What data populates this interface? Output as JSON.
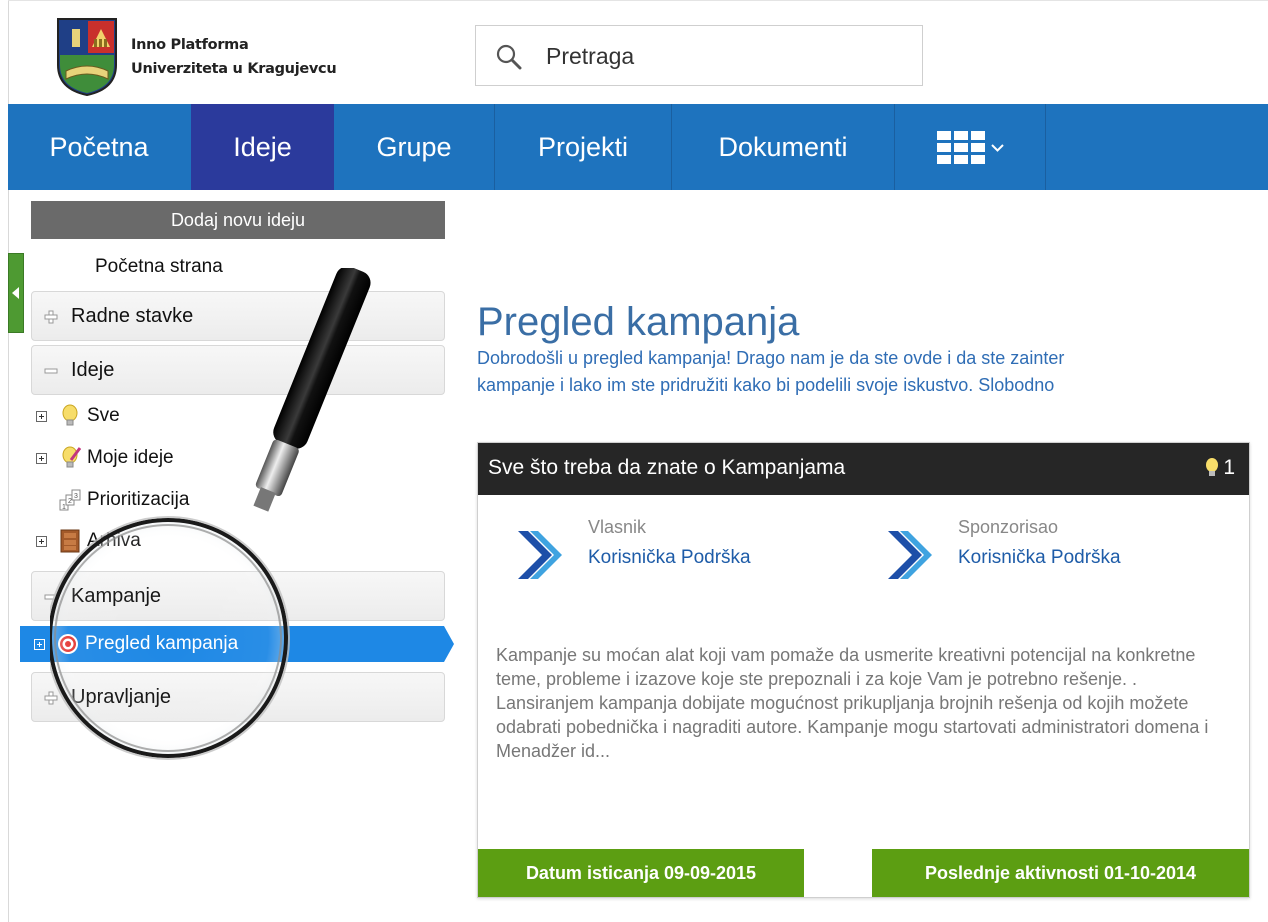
{
  "header": {
    "org_line1": "Inno Platforma",
    "org_line2": "Univerziteta u Kragujevcu",
    "search_placeholder": "Pretraga"
  },
  "nav": {
    "items": [
      {
        "label": "Početna"
      },
      {
        "label": "Ideje",
        "active": true
      },
      {
        "label": "Grupe"
      },
      {
        "label": "Projekti"
      },
      {
        "label": "Dokumenti"
      }
    ],
    "apps_icon": "apps-grid-icon"
  },
  "sidebar": {
    "add_button": "Dodaj novu ideju",
    "home_link": "Početna strana",
    "sections": {
      "radne_stavke": "Radne stavke",
      "ideje": "Ideje",
      "kampanje": "Kampanje",
      "upravljanje": "Upravljanje"
    },
    "ideje_items": [
      "Sve",
      "Moje ideje",
      "Prioritizacija",
      "Arhiva"
    ],
    "kampanje_items": [
      "Pregled kampanja"
    ],
    "selected_color": "#1e88e5"
  },
  "main": {
    "title": "Pregled kampanja",
    "intro_line1": "Dobrodošli u pregled kampanja! Drago nam je da ste ovde i da ste zainter",
    "intro_line2": "kampanje i lako im ste pridružiti kako bi podelili svoje iskustvo. Slobodno"
  },
  "card": {
    "title": "Sve što treba da znate o Kampanjama",
    "idea_count": "1",
    "owner_label": "Vlasnik",
    "owner_name": "Korisnička Podrška",
    "sponsor_label": "Sponzorisao",
    "sponsor_name": "Korisnička Podrška",
    "description": "Kampanje su moćan alat koji vam pomaže da usmerite kreativni potencijal na konkretne teme, probleme i izazove koje ste prepoznali i za koje Vam je potrebno rešenje. . Lansiranjem kampanja dobijate mogućnost prikupljanja brojnih rešenja od kojih možete odabrati pobednička i nagraditi autore. Kampanje mogu startovati administratori domena i Menadžer id...",
    "expiry": "Datum isticanja 09-09-2015",
    "last_activity": "Poslednje aktivnosti 01-10-2014",
    "badge_color": "#5c9e12"
  }
}
